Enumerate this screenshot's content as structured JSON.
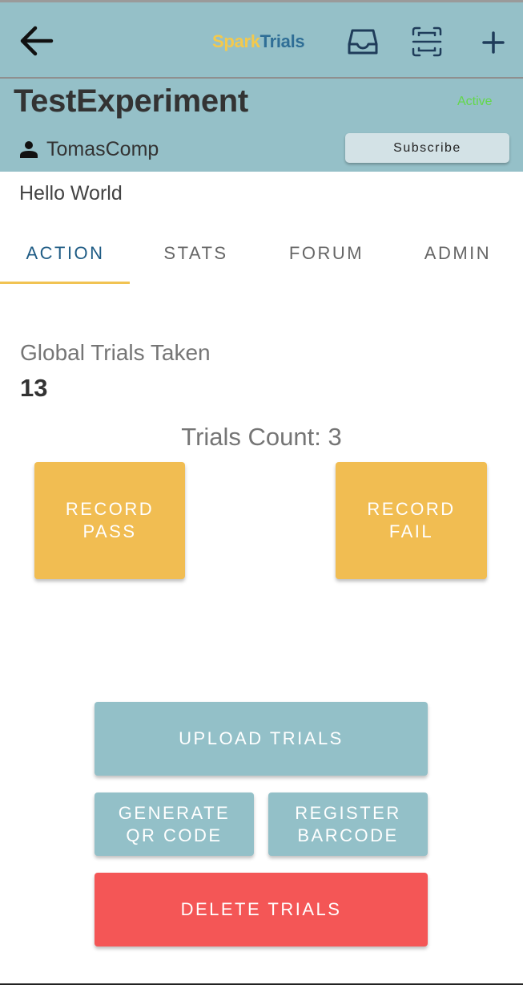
{
  "app_bar": {
    "brand_part1": "Spark",
    "brand_part2": "Trials",
    "icons": [
      "back-arrow-icon",
      "inbox-icon",
      "scan-icon",
      "add-icon"
    ]
  },
  "experiment": {
    "title": "TestExperiment",
    "status": "Active",
    "owner": "TomasComp",
    "subscribe_label": "Subscribe",
    "description": "Hello World"
  },
  "tabs": [
    {
      "label": "ACTION",
      "active": true
    },
    {
      "label": "STATS",
      "active": false
    },
    {
      "label": "FORUM",
      "active": false
    },
    {
      "label": "ADMIN",
      "active": false
    }
  ],
  "action": {
    "global_trials_label": "Global Trials Taken",
    "global_trials_value": "13",
    "trials_count_text": "Trials Count: 3",
    "record_pass": [
      "RECORD",
      "PASS"
    ],
    "record_fail": [
      "RECORD",
      "FAIL"
    ],
    "upload_label": "UPLOAD TRIALS",
    "generate_qr": [
      "GENERATE",
      "QR CODE"
    ],
    "register_barcode": [
      "REGISTER",
      "BARCODE"
    ],
    "delete_label": "DELETE TRIALS"
  },
  "colors": {
    "primary": "#95c0c8",
    "accent": "#f1bd52",
    "danger": "#f45656",
    "status_active": "#63d84a",
    "brand_yellow": "#f3c94d",
    "brand_blue": "#2f6e96"
  }
}
